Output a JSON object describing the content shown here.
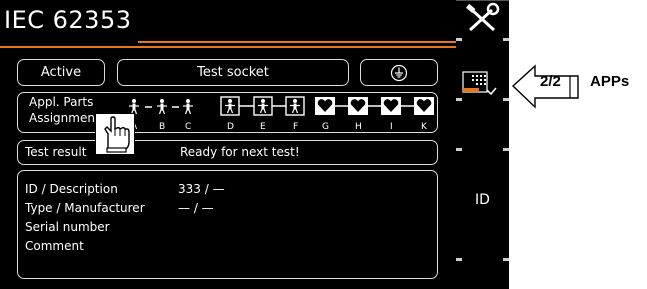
{
  "header": {
    "title": "IEC 62353"
  },
  "mode_row": {
    "status_label": "Active",
    "socket_label": "Test socket",
    "ground_icon": "protective-earth-icon"
  },
  "applied_parts": {
    "label_line1": "Appl. Parts",
    "label_line2": "Assignment",
    "letters": [
      "A",
      "B",
      "C",
      "D",
      "E",
      "F",
      "G",
      "H",
      "I",
      "K"
    ],
    "types": [
      "B",
      "B",
      "B",
      "BF",
      "BF",
      "BF",
      "CF",
      "CF",
      "CF",
      "CF"
    ]
  },
  "status": {
    "label": "Test result",
    "value": "Ready for next test!"
  },
  "device_info": {
    "id_label": "ID / Description",
    "id_value": "333 / —",
    "type_label": "Type / Manufacturer",
    "type_value": "— / —",
    "serial_label": "Serial number",
    "comment_label": "Comment"
  },
  "hand_icon": "pointing-hand-icon",
  "softkeys": {
    "setup_icon": "tools-icon",
    "apps_icon": "apps-icon",
    "id_label": "ID"
  },
  "callout": {
    "page": "2/2",
    "label": "APPs"
  },
  "colors": {
    "accent": "#e8781e",
    "screen_bg": "#000000"
  }
}
